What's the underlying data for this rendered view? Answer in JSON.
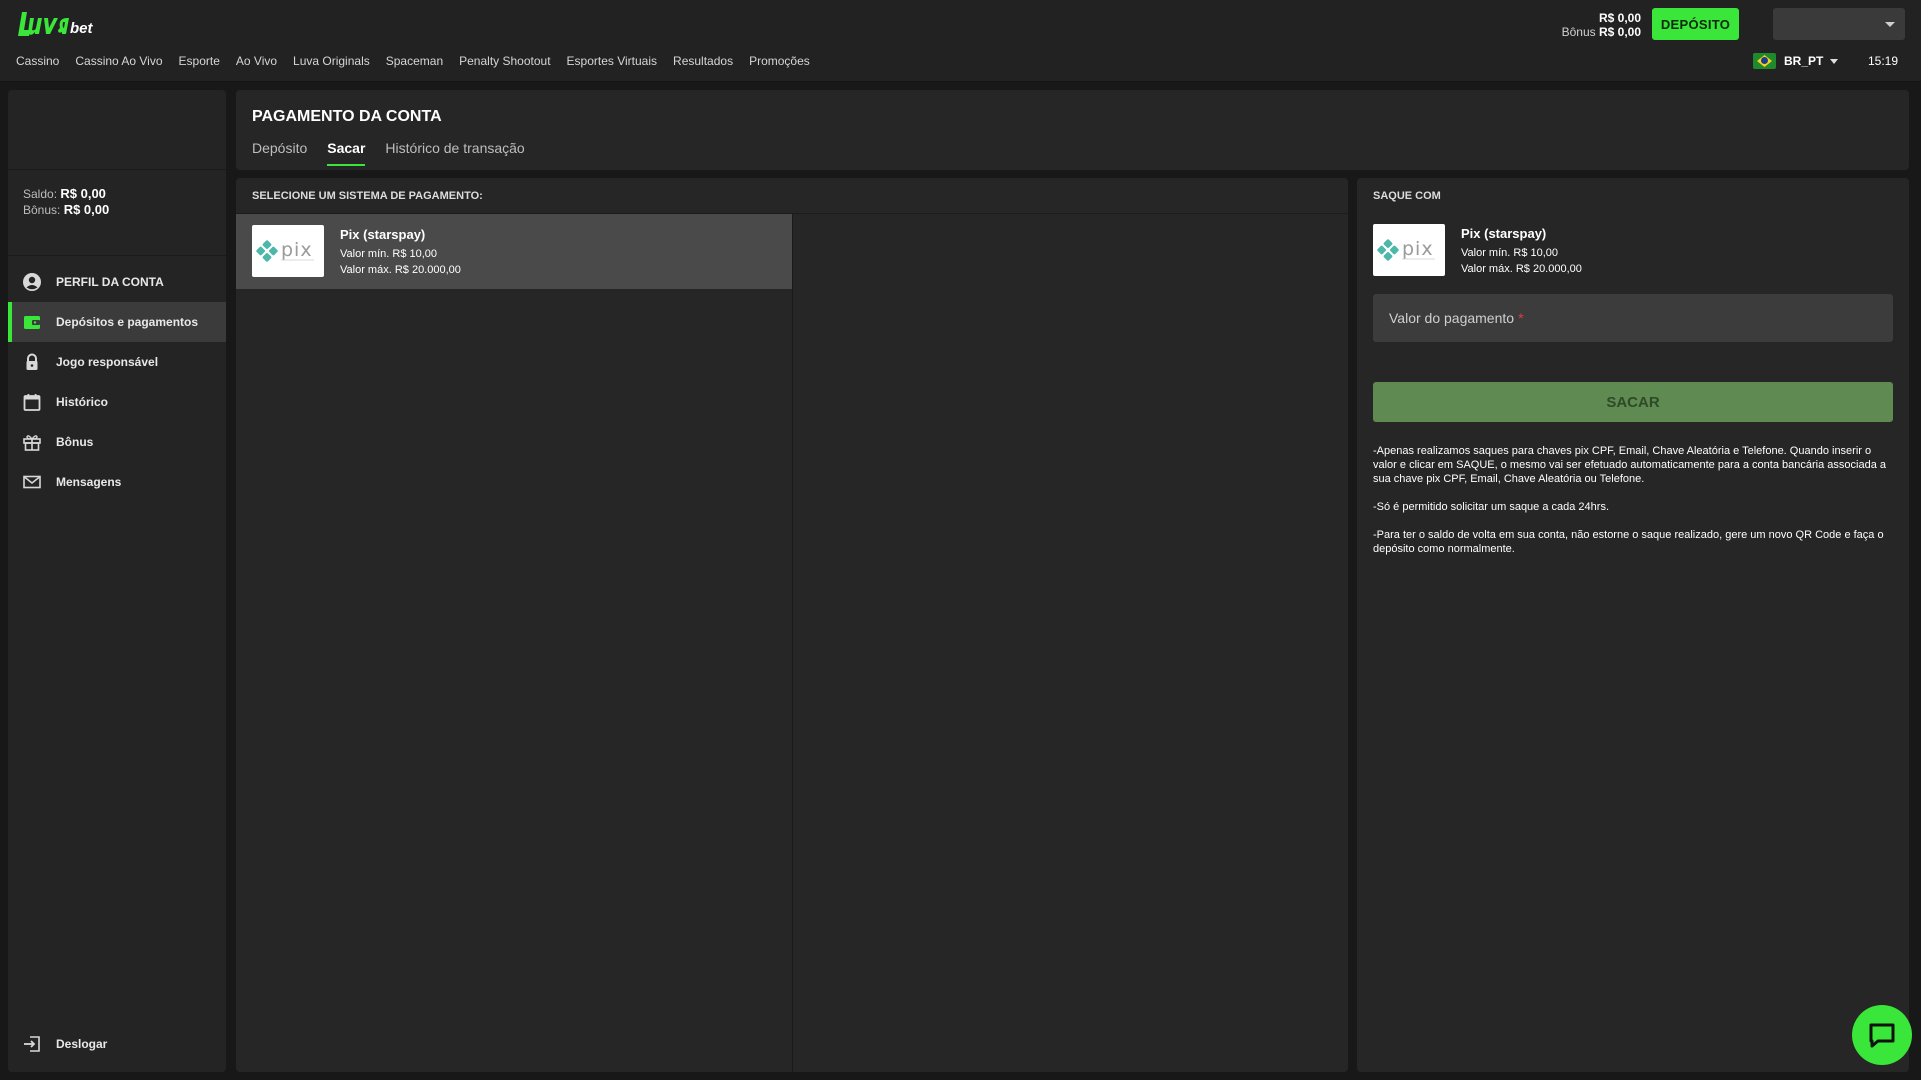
{
  "header": {
    "logo_text": "Luva.bet",
    "nav": [
      "Cassino",
      "Cassino Ao Vivo",
      "Esporte",
      "Ao Vivo",
      "Luva Originals",
      "Spaceman",
      "Penalty Shootout",
      "Esportes Virtuais",
      "Resultados",
      "Promoções"
    ],
    "balance": "R$ 0,00",
    "bonus_label": "Bônus",
    "bonus_value": "R$ 0,00",
    "deposit_label": "DEPÓSITO",
    "language": "BR_PT",
    "time": "15:19"
  },
  "sidebar": {
    "saldo_label": "Saldo:",
    "saldo_value": "R$ 0,00",
    "bonus_label": "Bônus:",
    "bonus_value": "R$ 0,00",
    "items": [
      {
        "label": "PERFIL DA CONTA",
        "icon": "user-circle-icon"
      },
      {
        "label": "Depósitos e pagamentos",
        "icon": "wallet-icon",
        "active": true
      },
      {
        "label": "Jogo responsável",
        "icon": "lock-icon"
      },
      {
        "label": "Histórico",
        "icon": "calendar-icon"
      },
      {
        "label": "Bônus",
        "icon": "gift-icon"
      },
      {
        "label": "Mensagens",
        "icon": "mail-icon"
      }
    ],
    "logout_label": "Deslogar"
  },
  "main": {
    "title": "PAGAMENTO DA CONTA",
    "tabs": [
      "Depósito",
      "Sacar",
      "Histórico de transação"
    ],
    "active_tab": "Sacar",
    "methods_header": "SELECIONE UM SISTEMA DE PAGAMENTO:",
    "method": {
      "name": "Pix (starspay)",
      "min_label": "Valor mín.",
      "min_value": "R$ 10,00",
      "max_label": "Valor máx.",
      "max_value": "R$ 20.000,00"
    }
  },
  "saque": {
    "header": "SAQUE COM",
    "amount_placeholder": "Valor do pagamento",
    "required_mark": "*",
    "button_label": "SACAR",
    "notes": [
      "-Apenas realizamos saques para chaves pix CPF, Email, Chave Aleatória e Telefone. Quando inserir o valor e clicar em SAQUE, o mesmo vai ser efetuado automaticamente para a conta bancária associada a sua chave pix CPF, Email, Chave Aleatória ou Telefone.",
      "-Só é permitido solicitar um saque a cada 24hrs.",
      "-Para ter o saldo de volta em sua conta, não estorne o saque realizado, gere um novo QR Code e faça o depósito como normalmente."
    ]
  },
  "colors": {
    "accent": "#39e639",
    "background": "#181818",
    "panel": "#262626",
    "button_disabled": "#5f8a51",
    "pix_teal": "#4bb8a9"
  }
}
